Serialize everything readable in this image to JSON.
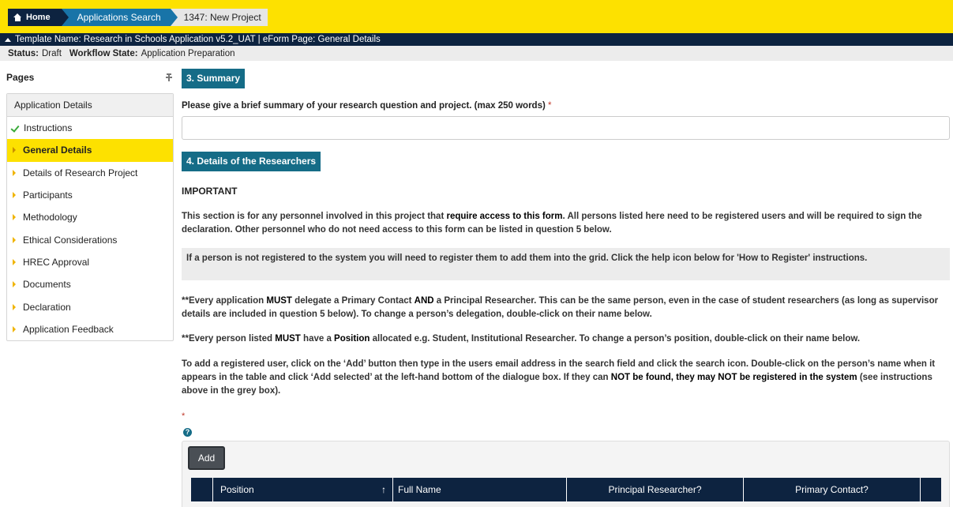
{
  "breadcrumbs": {
    "home": "Home",
    "search": "Applications Search",
    "current": "1347: New Project"
  },
  "template_bar": "Template Name: Research in Schools Application v5.2_UAT | eForm Page: General Details",
  "status": {
    "status_label": "Status:",
    "status_value": "Draft",
    "workflow_label": "Workflow State:",
    "workflow_value": "Application Preparation"
  },
  "sidebar": {
    "title": "Pages",
    "group": "Application Details",
    "items": [
      {
        "label": "Instructions"
      },
      {
        "label": "General Details"
      },
      {
        "label": "Details of Research Project"
      },
      {
        "label": "Participants"
      },
      {
        "label": "Methodology"
      },
      {
        "label": "Ethical Considerations"
      },
      {
        "label": "HREC Approval"
      },
      {
        "label": "Documents"
      },
      {
        "label": "Declaration"
      },
      {
        "label": "Application Feedback"
      }
    ]
  },
  "main": {
    "section3": "3. Summary",
    "summary_question": "Please give a brief summary of your research question and project. (max 250 words)",
    "required_mark": "*",
    "summary_value": "",
    "section4": "4. Details of the Researchers",
    "important": "IMPORTANT",
    "p1_a": "This section is for any personnel involved in this project that ",
    "p1_b": "require access to this form",
    "p1_c": ". All persons listed here need to be registered users and will be required to sign the declaration. Other personnel who do not need access to this form can be listed in question 5 below.",
    "greybox": "If a person is not registered to the system you will need to register them to add them into the grid. Click the help icon below for 'How to Register' instructions.",
    "p2_a": "**Every application ",
    "p2_b": "MUST",
    "p2_c": " delegate a Primary Contact ",
    "p2_d": "AND",
    "p2_e": " a Principal Researcher. This can be the same person, even in the case of student researchers (as long as supervisor details are included in question 5 below). To change a person’s delegation, double-click on their name below.",
    "p3_a": "**Every person listed ",
    "p3_b": "MUST",
    "p3_c": " have a ",
    "p3_d": "Position",
    "p3_e": " allocated e.g. Student, Institutional Researcher. To change a person’s position, double-click on their name below.",
    "p4_a": "To add a registered user, click on the ‘Add’ button then type in the users email address in the search field and click the search icon. Double-click on the person’s name when it appears in the table and click ‘Add selected’ at the left-hand bottom of the dialogue box. If they can ",
    "p4_b": "NOT be found, they may NOT be registered in the system",
    "p4_c": " (see instructions above in the grey box).",
    "help_glyph": "?"
  },
  "grid": {
    "add_label": "Add",
    "columns": {
      "position": "Position",
      "sort_glyph": "↑",
      "full_name": "Full Name",
      "principal": "Principal Researcher?",
      "primary": "Primary Contact?"
    }
  },
  "colors": {
    "brand_yellow": "#fde100",
    "navy": "#0d2340",
    "section_teal": "#156c87",
    "breadcrumb_blue": "#1874a8"
  }
}
